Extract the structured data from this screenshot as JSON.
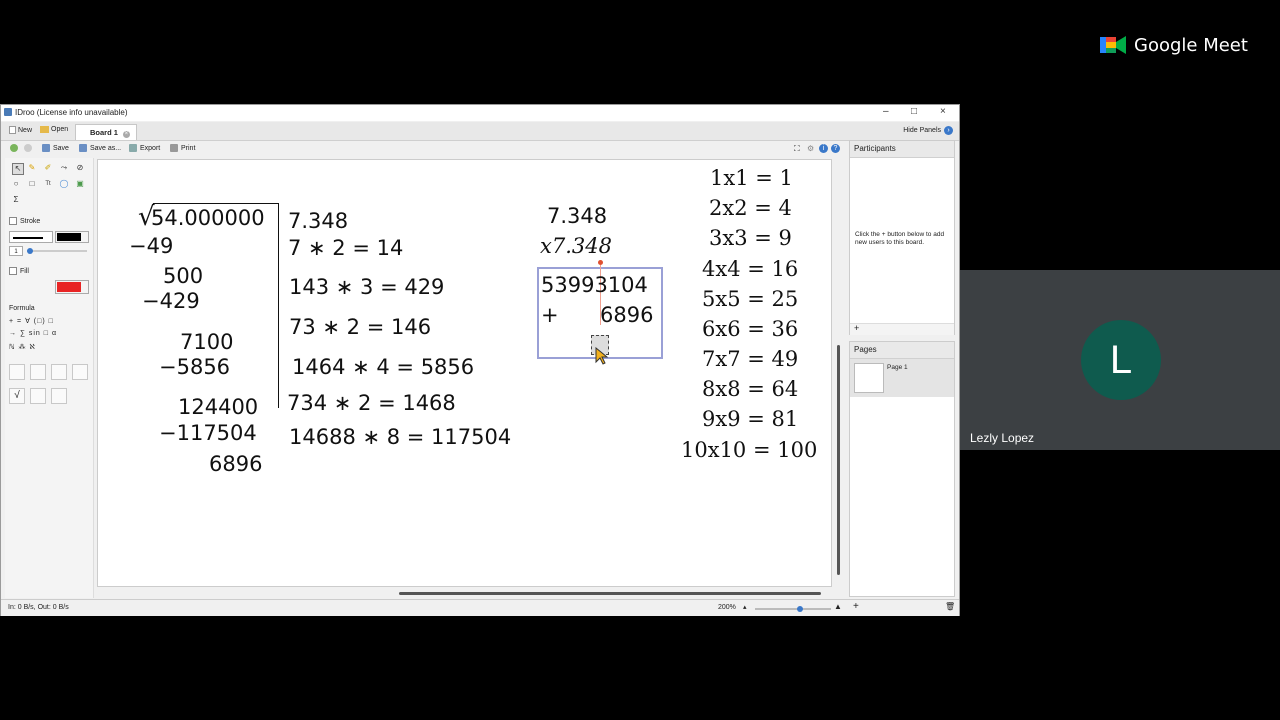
{
  "meet": {
    "logo_text": "Google Meet",
    "participant_name": "Lezly Lopez",
    "avatar_letter": "L",
    "avatar_color": "#0f5b4e"
  },
  "window": {
    "title": "IDroo (License info unavailable)",
    "tabs": {
      "new": "New",
      "open": "Open",
      "board": "Board 1",
      "hide_panels": "Hide Panels"
    },
    "toolbar": {
      "save": "Save",
      "save_as": "Save as...",
      "export": "Export",
      "print": "Print"
    }
  },
  "tools": {
    "stroke_label": "Stroke",
    "stroke_width_value": "1",
    "fill_label": "Fill",
    "fill_color": "#e82424",
    "stroke_color": "#000000",
    "formula_label": "Formula",
    "formula_row1": "+  =  ∀  (□)  □",
    "formula_row2": "→  ∑  sin □  α",
    "formula_row3": "ℕ  ⁂  ℵ"
  },
  "board": {
    "division": {
      "dividend": "54.000000",
      "steps": [
        "−49",
        "500",
        "−429",
        "7100",
        "−5856",
        "124400",
        "−117504",
        "6896"
      ]
    },
    "middle_column": [
      "7.348",
      "7 ∗ 2 = 14",
      "143 ∗ 3 = 429",
      "73 ∗ 2 = 146",
      "1464 ∗ 4 = 5856",
      "734 ∗ 2 = 1468",
      "14688 ∗ 8 = 117504"
    ],
    "product": {
      "top": "7.348",
      "multiplier": "x7.348",
      "row1": "53993104",
      "plus": "+",
      "row2": "6896"
    },
    "squares": [
      "1x1 = 1",
      "2x2 = 4",
      "3x3 = 9",
      "4x4 = 16",
      "5x5 = 25",
      "6x6 = 36",
      "7x7 = 49",
      "8x8 = 64",
      "9x9 = 81",
      "10x10 = 100"
    ]
  },
  "panels": {
    "participants_title": "Participants",
    "participants_hint": "Click the + button below to add new users to this board.",
    "pages_title": "Pages",
    "page_item": "Page 1"
  },
  "status": {
    "io": "In: 0 B/s, Out: 0 B/s",
    "zoom": "200%"
  }
}
